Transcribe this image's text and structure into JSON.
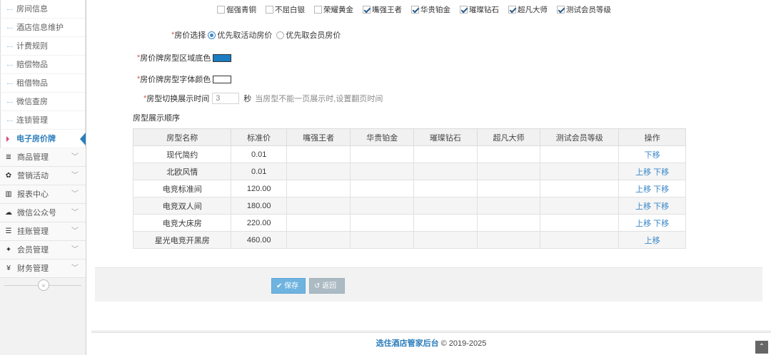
{
  "sidebar": {
    "sub_items": [
      {
        "label": "房间信息",
        "active": false
      },
      {
        "label": "酒店信息维护",
        "active": false
      },
      {
        "label": "计费规则",
        "active": false
      },
      {
        "label": "赔偿物品",
        "active": false
      },
      {
        "label": "租借物品",
        "active": false
      },
      {
        "label": "微信查房",
        "active": false
      },
      {
        "label": "连锁管理",
        "active": false
      },
      {
        "label": "电子房价牌",
        "active": true
      }
    ],
    "menu_items": [
      {
        "label": "商品管理",
        "icon": "database-icon",
        "glyph": "≣"
      },
      {
        "label": "营销活动",
        "icon": "gift-icon",
        "glyph": "✿"
      },
      {
        "label": "报表中心",
        "icon": "bar-chart-icon",
        "glyph": "▥"
      },
      {
        "label": "微信公众号",
        "icon": "cloud-icon",
        "glyph": "☁"
      },
      {
        "label": "挂账管理",
        "icon": "list-icon",
        "glyph": "☰"
      },
      {
        "label": "会员管理",
        "icon": "users-icon",
        "glyph": "✦"
      },
      {
        "label": "财务管理",
        "icon": "cutlery-icon",
        "glyph": "¥"
      }
    ],
    "collapse_glyph": "«"
  },
  "member_levels": [
    {
      "label": "倔强青铜",
      "checked": false
    },
    {
      "label": "不屈白银",
      "checked": false
    },
    {
      "label": "荣耀黄金",
      "checked": false
    },
    {
      "label": "嘴强王者",
      "checked": true
    },
    {
      "label": "华贵铂金",
      "checked": true
    },
    {
      "label": "璀璨钻石",
      "checked": true
    },
    {
      "label": "超凡大师",
      "checked": true
    },
    {
      "label": "测试会员等级",
      "checked": true
    }
  ],
  "form": {
    "price_choice": {
      "label": "房价选择",
      "options": [
        {
          "label": "优先取活动房价",
          "selected": true
        },
        {
          "label": "优先取会员房价",
          "selected": false
        }
      ]
    },
    "bg_color": {
      "label": "房价牌房型区域底色",
      "value": "#1a7dc1"
    },
    "font_color": {
      "label": "房价牌房型字体颜色",
      "value": "#ffffff"
    },
    "switch_time": {
      "label": "房型切换展示时间",
      "value": "3",
      "unit": "秒",
      "hint": "当房型不能一页展示时,设置翻页时间"
    },
    "required_mark": "*",
    "order_label": "房型展示顺序"
  },
  "table": {
    "headers": [
      "房型名称",
      "标准价",
      "嘴强王者",
      "华贵铂金",
      "璀璨钻石",
      "超凡大师",
      "测试会员等级",
      "操作"
    ],
    "rows": [
      {
        "name": "现代简约",
        "price": "0.01",
        "up": "",
        "down": "下移"
      },
      {
        "name": "北欧风情",
        "price": "0.01",
        "up": "上移",
        "down": "下移"
      },
      {
        "name": "电竞标准间",
        "price": "120.00",
        "up": "上移",
        "down": "下移"
      },
      {
        "name": "电竞双人间",
        "price": "180.00",
        "up": "上移",
        "down": "下移"
      },
      {
        "name": "电竞大床房",
        "price": "220.00",
        "up": "上移",
        "down": "下移"
      },
      {
        "name": "星光电竞开黑房",
        "price": "460.00",
        "up": "上移",
        "down": ""
      }
    ]
  },
  "actions": {
    "save": "保存",
    "back": "返回"
  },
  "footer": {
    "brand": "选住酒店管家后台",
    "copyright": "© 2019-2025"
  },
  "scroll_top_glyph": "⌃"
}
